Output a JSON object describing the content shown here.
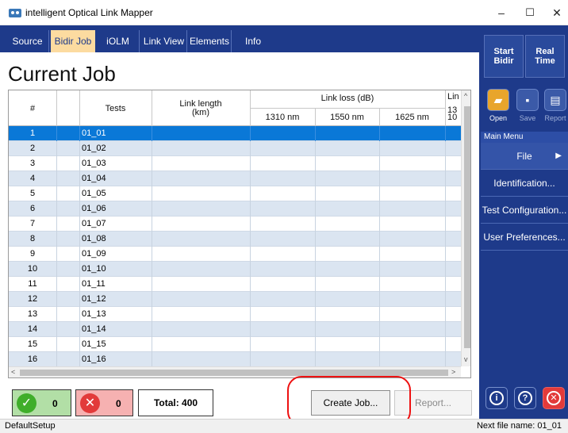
{
  "window": {
    "title": "intelligent Optical Link Mapper"
  },
  "tabs": [
    "Source",
    "Bidir Job",
    "iOLM",
    "Link View",
    "Elements",
    "Info"
  ],
  "page_title": "Current Job",
  "table": {
    "headers": {
      "num": "#",
      "tests": "Tests",
      "link_length": "Link length",
      "link_length_unit": "(km)",
      "link_loss": "Link loss (dB)",
      "wl1": "1310 nm",
      "wl2": "1550 nm",
      "wl3": "1625 nm",
      "cut_top": "Lin",
      "cut_wl1": "13",
      "cut_wl2": "10"
    },
    "rows": [
      {
        "num": "1",
        "test": "01_01"
      },
      {
        "num": "2",
        "test": "01_02"
      },
      {
        "num": "3",
        "test": "01_03"
      },
      {
        "num": "4",
        "test": "01_04"
      },
      {
        "num": "5",
        "test": "01_05"
      },
      {
        "num": "6",
        "test": "01_06"
      },
      {
        "num": "7",
        "test": "01_07"
      },
      {
        "num": "8",
        "test": "01_08"
      },
      {
        "num": "9",
        "test": "01_09"
      },
      {
        "num": "10",
        "test": "01_10"
      },
      {
        "num": "11",
        "test": "01_11"
      },
      {
        "num": "12",
        "test": "01_12"
      },
      {
        "num": "13",
        "test": "01_13"
      },
      {
        "num": "14",
        "test": "01_14"
      },
      {
        "num": "15",
        "test": "01_15"
      },
      {
        "num": "16",
        "test": "01_16"
      }
    ]
  },
  "bottom": {
    "pass_count": "0",
    "fail_count": "0",
    "total": "Total: 400",
    "create_job": "Create Job...",
    "report": "Report..."
  },
  "status": {
    "left": "DefaultSetup",
    "right": "Next file name: 01_01"
  },
  "right_panel": {
    "start_bidir": "Start Bidir",
    "real_time": "Real Time",
    "open": "Open",
    "save": "Save",
    "report": "Report",
    "main_menu": "Main Menu",
    "file": "File",
    "identification": "Identification...",
    "test_configuration": "Test Configuration...",
    "user_preferences": "User Preferences..."
  },
  "colors": {
    "accent": "#1e3a8a",
    "selected_row": "#0a78d7",
    "pass": "#3fae2a",
    "fail": "#e23a3a"
  }
}
